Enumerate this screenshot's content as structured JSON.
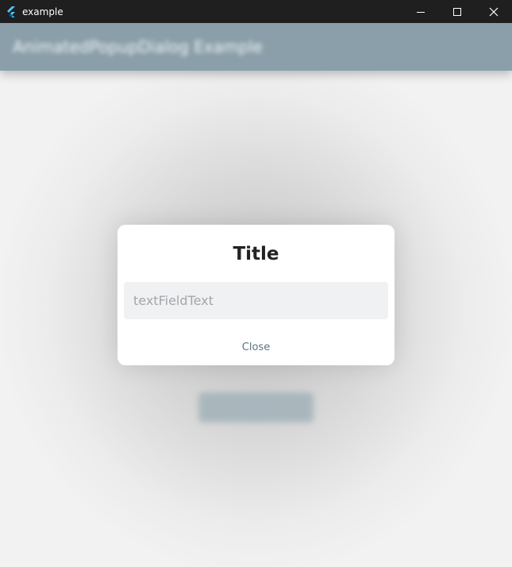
{
  "window": {
    "title": "example",
    "controls": [
      "minimize-icon",
      "maximize-icon",
      "close-icon"
    ]
  },
  "appbar": {
    "title": "AnimatedPopupDialog Example"
  },
  "dialog": {
    "title": "Title",
    "input_placeholder": "textFieldText",
    "close_label": "Close"
  },
  "colors": {
    "titlebar_bg": "#1f1f1f",
    "appbar_bg": "#8a9fa9",
    "dialog_bg": "#ffffff",
    "input_bg": "#f0f1f3",
    "close_text": "#5b7481"
  }
}
